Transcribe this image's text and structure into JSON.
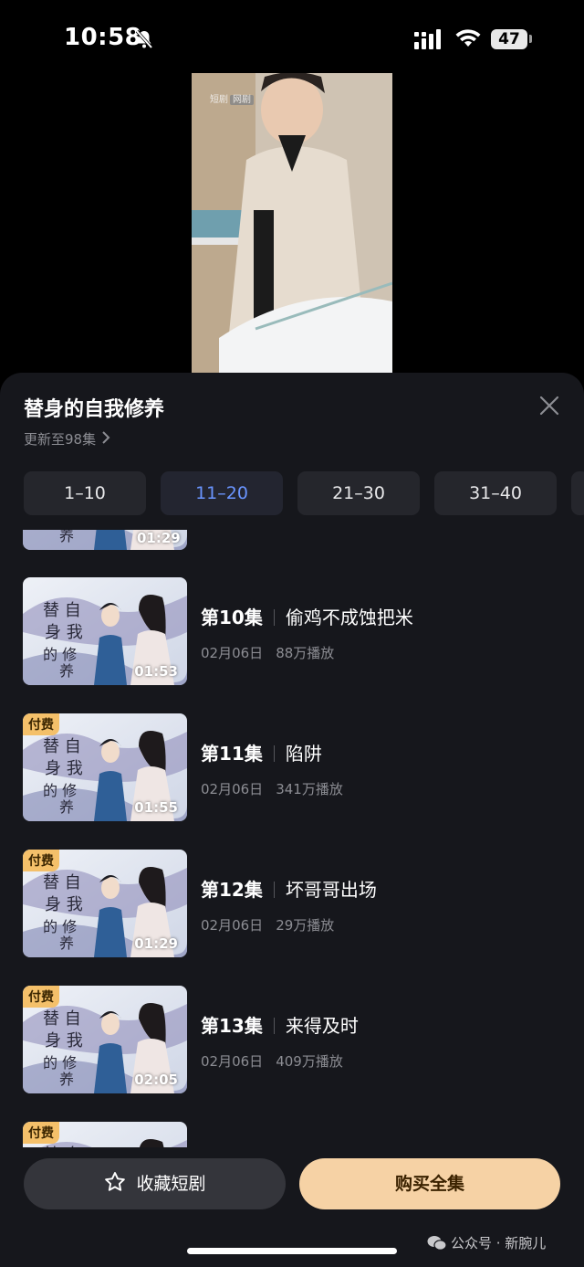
{
  "status_bar": {
    "time": "10:58",
    "battery": "47"
  },
  "video": {
    "watermark": "短剧",
    "watermark_tag": "网剧"
  },
  "sheet": {
    "title": "替身的自我修养",
    "update_text": "更新至98集",
    "tabs": [
      "1–10",
      "11–20",
      "21–30",
      "31–40"
    ],
    "active_tab": "11–20"
  },
  "episodes": [
    {
      "duration": "01:29",
      "badge": ""
    },
    {
      "number": "第10集",
      "name": "偷鸡不成蚀把米",
      "date": "02月06日",
      "plays": "88万播放",
      "duration": "01:53",
      "badge": ""
    },
    {
      "number": "第11集",
      "name": "陷阱",
      "date": "02月06日",
      "plays": "341万播放",
      "duration": "01:55",
      "badge": "付费"
    },
    {
      "number": "第12集",
      "name": "坏哥哥出场",
      "date": "02月06日",
      "plays": "29万播放",
      "duration": "01:29",
      "badge": "付费"
    },
    {
      "number": "第13集",
      "name": "来得及时",
      "date": "02月06日",
      "plays": "409万播放",
      "duration": "02:05",
      "badge": "付费"
    },
    {
      "badge": "付费"
    }
  ],
  "actions": {
    "favorite_label": "收藏短剧",
    "buy_label": "购买全集"
  },
  "watermark": "公众号 · 新腕儿",
  "colors": {
    "accent_tab": "#6a95ff",
    "buy_button": "#f6d2a5",
    "paid_badge": "#f4c06a",
    "sheet_bg": "#16171c"
  }
}
